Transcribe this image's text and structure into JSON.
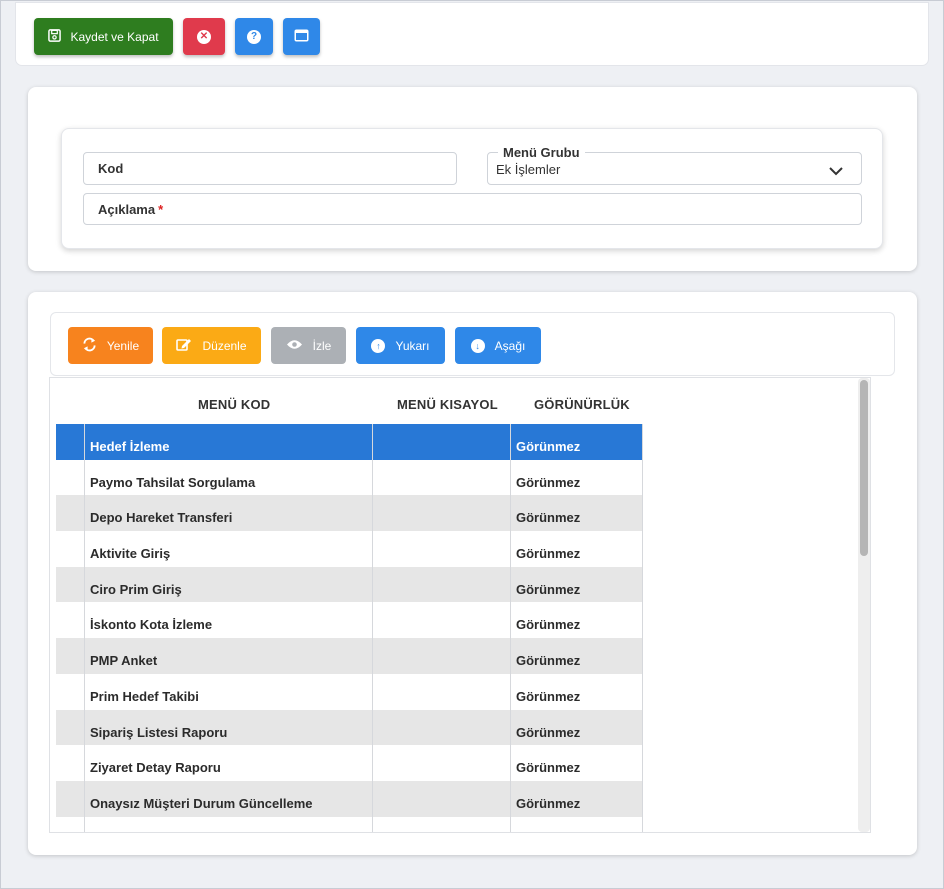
{
  "toolbar": {
    "save_close_label": "Kaydet ve Kapat"
  },
  "form": {
    "kod_label": "Kod",
    "menu_grubu_label": "Menü Grubu",
    "menu_grubu_value": "Ek İşlemler",
    "aciklama_label": "Açıklama",
    "required_mark": "*"
  },
  "actions": {
    "refresh_label": "Yenile",
    "edit_label": "Düzenle",
    "view_label": "İzle",
    "up_label": "Yukarı",
    "down_label": "Aşağı"
  },
  "grid": {
    "columns": [
      "MENÜ KOD",
      "MENÜ KISAYOL",
      "GÖRÜNÜRLÜK"
    ],
    "rows": [
      {
        "kod": "Hedef İzleme",
        "kisayol": "",
        "gorunurluk": "Görünmez",
        "selected": true
      },
      {
        "kod": "Paymo Tahsilat Sorgulama",
        "kisayol": "",
        "gorunurluk": "Görünmez"
      },
      {
        "kod": "Depo Hareket Transferi",
        "kisayol": "",
        "gorunurluk": "Görünmez"
      },
      {
        "kod": "Aktivite Giriş",
        "kisayol": "",
        "gorunurluk": "Görünmez"
      },
      {
        "kod": "Ciro Prim Giriş",
        "kisayol": "",
        "gorunurluk": "Görünmez"
      },
      {
        "kod": "İskonto Kota İzleme",
        "kisayol": "",
        "gorunurluk": "Görünmez"
      },
      {
        "kod": "PMP Anket",
        "kisayol": "",
        "gorunurluk": "Görünmez"
      },
      {
        "kod": "Prim Hedef Takibi",
        "kisayol": "",
        "gorunurluk": "Görünmez"
      },
      {
        "kod": "Sipariş Listesi Raporu",
        "kisayol": "",
        "gorunurluk": "Görünmez"
      },
      {
        "kod": "Ziyaret Detay Raporu",
        "kisayol": "",
        "gorunurluk": "Görünmez"
      },
      {
        "kod": "Onaysız Müşteri Durum Güncelleme",
        "kisayol": "",
        "gorunurluk": "Görünmez"
      }
    ]
  },
  "colors": {
    "save": "#2e7d1f",
    "cancel": "#e03a4c",
    "primary": "#2f88e8",
    "refresh": "#f7831e",
    "edit": "#fbaa15",
    "view": "#acb0b5",
    "selected_row": "#2878d6",
    "alt_row": "#e6e6e6"
  }
}
